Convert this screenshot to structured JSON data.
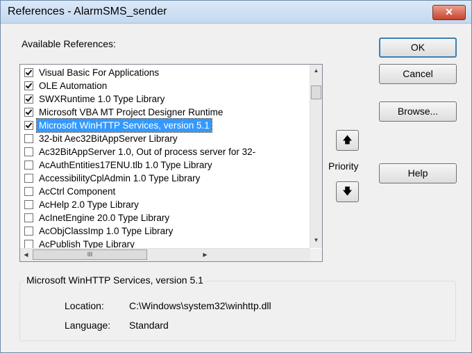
{
  "window": {
    "title": "References - AlarmSMS_sender",
    "close_glyph": "✕"
  },
  "available_label": "Available References:",
  "references": [
    {
      "label": "Visual Basic For Applications",
      "checked": true,
      "selected": false
    },
    {
      "label": "OLE Automation",
      "checked": true,
      "selected": false
    },
    {
      "label": "SWXRuntime 1.0 Type Library",
      "checked": true,
      "selected": false
    },
    {
      "label": "Microsoft VBA MT Project Designer Runtime",
      "checked": true,
      "selected": false
    },
    {
      "label": "Microsoft WinHTTP Services, version 5.1",
      "checked": true,
      "selected": true
    },
    {
      "label": "32-bit Aec32BitAppServer Library",
      "checked": false,
      "selected": false
    },
    {
      "label": "Ac32BitAppServer 1.0, Out of process server for 32-",
      "checked": false,
      "selected": false
    },
    {
      "label": "AcAuthEntities17ENU.tlb 1.0 Type Library",
      "checked": false,
      "selected": false
    },
    {
      "label": "AccessibilityCplAdmin 1.0 Type Library",
      "checked": false,
      "selected": false
    },
    {
      "label": "AcCtrl Component",
      "checked": false,
      "selected": false
    },
    {
      "label": "AcHelp 2.0 Type Library",
      "checked": false,
      "selected": false
    },
    {
      "label": "AcInetEngine 20.0 Type Library",
      "checked": false,
      "selected": false
    },
    {
      "label": "AcObjClassImp 1.0 Type Library",
      "checked": false,
      "selected": false
    },
    {
      "label": "AcPublish Type Library",
      "checked": false,
      "selected": false
    }
  ],
  "buttons": {
    "ok": "OK",
    "cancel": "Cancel",
    "browse": "Browse...",
    "help": "Help"
  },
  "priority": {
    "label": "Priority",
    "up_glyph": "🡅",
    "down_glyph": "🡇"
  },
  "scrollbar": {
    "up_glyph": "▲",
    "down_glyph": "▼",
    "left_glyph": "◀",
    "right_glyph": "▶",
    "thumb_grip": "III"
  },
  "details": {
    "title": "Microsoft WinHTTP Services, version 5.1",
    "location_label": "Location:",
    "location_value": "C:\\Windows\\system32\\winhttp.dll",
    "language_label": "Language:",
    "language_value": "Standard"
  }
}
